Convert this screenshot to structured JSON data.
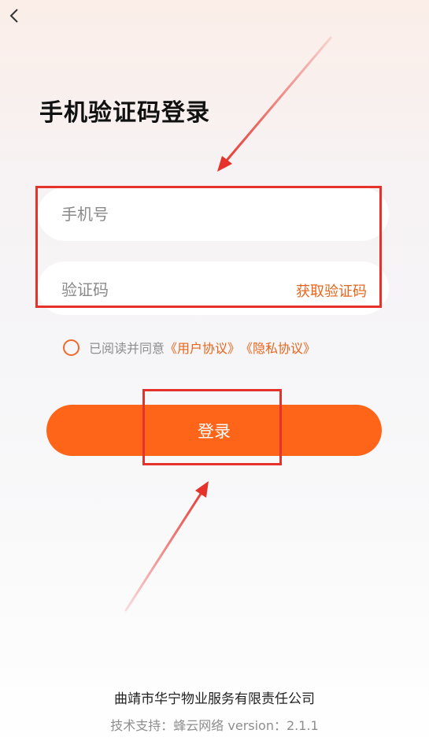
{
  "header": {
    "back_icon": "chevron-left-icon",
    "title": "手机验证码登录"
  },
  "form": {
    "phone_placeholder": "手机号",
    "phone_value": "",
    "code_placeholder": "验证码",
    "code_value": "",
    "get_code_label": "获取验证码"
  },
  "agreement": {
    "checked": false,
    "prefix": "已阅读并同意",
    "user_agreement": "《用户协议》",
    "privacy_policy": "《隐私协议》"
  },
  "login": {
    "label": "登录"
  },
  "footer": {
    "company": "曲靖市华宁物业服务有限责任公司",
    "tech_support": "技术支持：蜂云网络 version：2.1.1"
  },
  "colors": {
    "accent": "#ff6518",
    "link": "#e8651b",
    "annotation": "#e5322a"
  }
}
